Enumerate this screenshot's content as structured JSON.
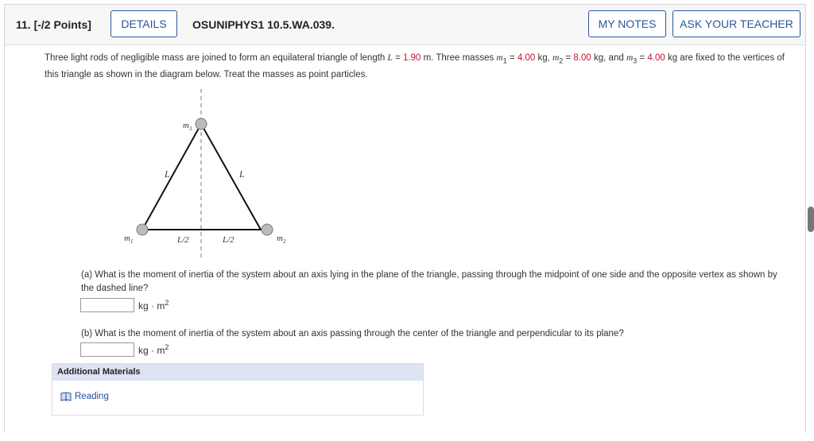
{
  "header": {
    "question_number": "11.  [-/2 Points]",
    "details_label": "DETAILS",
    "question_id": "OSUNIPHYS1 10.5.WA.039.",
    "my_notes_label": "MY NOTES",
    "ask_teacher_label": "ASK YOUR TEACHER"
  },
  "problem": {
    "t1": "Three light rods of negligible mass are joined to form an equilateral triangle of length ",
    "L_sym": "L",
    "eq": " = ",
    "L_val": "1.90",
    "t2": " m. Three masses ",
    "m1_sym": "m",
    "m1_sub": "1",
    "m1_val": "4.00",
    "kg_comma": " kg, ",
    "m2_sym": "m",
    "m2_sub": "2",
    "m2_val": "8.00",
    "kg_and": " kg, and ",
    "m3_sym": "m",
    "m3_sub": "3",
    "m3_val": "4.00",
    "t3": " kg are fixed to the vertices of this triangle as shown in the diagram below. Treat the masses as point particles."
  },
  "diagram": {
    "m1": "m",
    "m1_sub": "1",
    "m2": "m",
    "m2_sub": "2",
    "m3": "m",
    "m3_sub": "3",
    "L_left": "L",
    "L_right": "L",
    "half_left": "L/2",
    "half_right": "L/2"
  },
  "part_a": {
    "question": "(a) What is the moment of inertia of the system about an axis lying in the plane of the triangle, passing through the midpoint of one side and the opposite vertex as shown by the dashed line?",
    "input_value": "",
    "unit": "kg · m",
    "unit_exp": "2"
  },
  "part_b": {
    "question": "(b) What is the moment of inertia of the system about an axis passing through the center of the triangle and perpendicular to its plane?",
    "input_value": "",
    "unit": "kg · m",
    "unit_exp": "2"
  },
  "additional": {
    "title": "Additional Materials",
    "reading_label": "Reading"
  },
  "colors": {
    "accent": "#2b5797",
    "given_value": "#c8102e",
    "materials_header": "#dde3f3"
  }
}
